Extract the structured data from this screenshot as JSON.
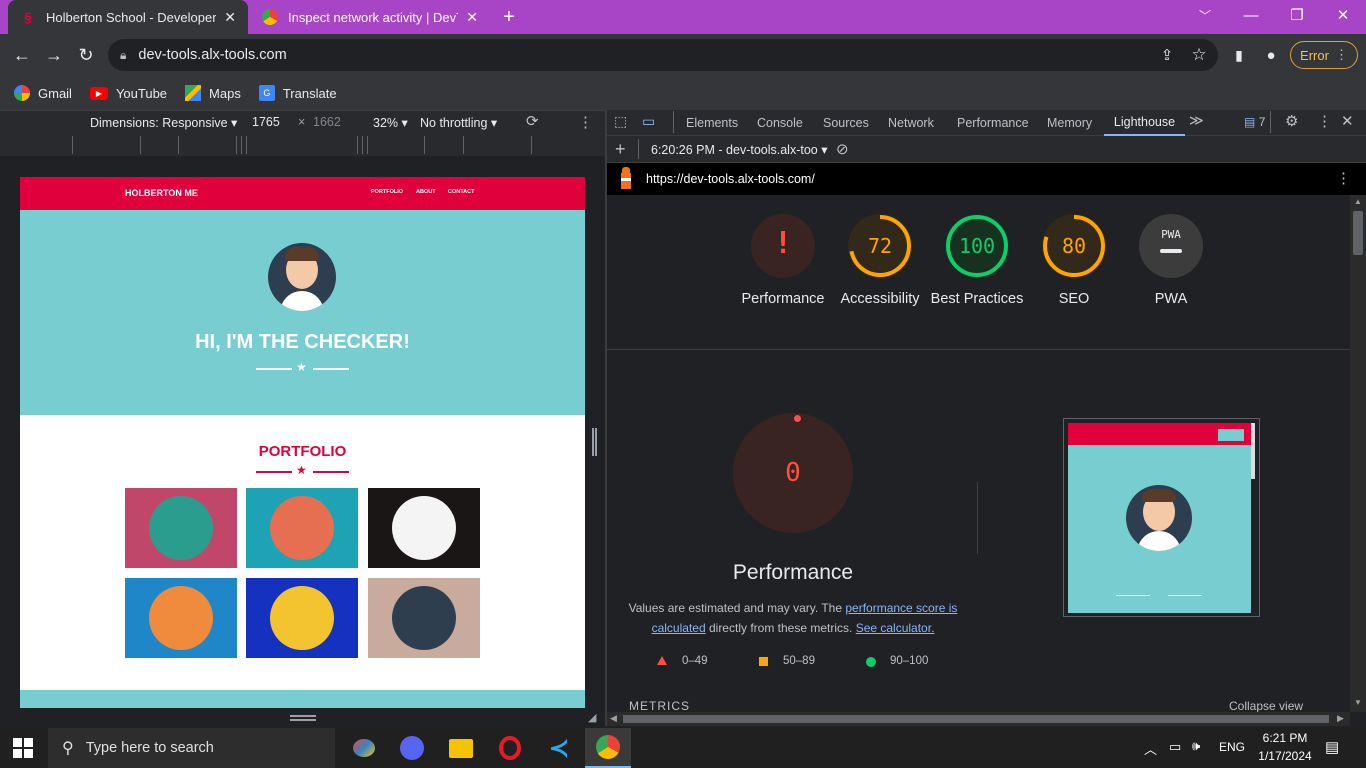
{
  "browser": {
    "tabs": [
      {
        "title": "Holberton School - Developer to",
        "active": true
      },
      {
        "title": "Inspect network activity | DevTo",
        "active": false
      }
    ],
    "new_tab": "+",
    "url": "dev-tools.alx-tools.com",
    "error_label": "Error",
    "bookmarks": [
      "Gmail",
      "YouTube",
      "Maps",
      "Translate"
    ]
  },
  "device_toolbar": {
    "dimensions": "Dimensions: Responsive",
    "width": "1765",
    "times": "×",
    "height": "1662",
    "zoom": "32%",
    "throttling": "No throttling"
  },
  "webpage": {
    "brand": "HOLBERTON ME",
    "nav": [
      "PORTFOLIO",
      "ABOUT",
      "CONTACT"
    ],
    "hero_title": "HI, I'M THE CHECKER!",
    "section_title": "PORTFOLIO",
    "tile_colors": [
      "#c1476a",
      "#1ea3b5",
      "#1a1616",
      "#1f86c8",
      "#1431c0",
      "#c9ab9e"
    ]
  },
  "devtools": {
    "tabs": [
      "Elements",
      "Console",
      "Sources",
      "Network",
      "Performance",
      "Memory",
      "Lighthouse"
    ],
    "active_tab": "Lighthouse",
    "issues_count": "7",
    "report_time": "6:20:26 PM - dev-tools.alx-too",
    "report_url": "https://dev-tools.alx-tools.com/",
    "scores": [
      {
        "label": "Performance",
        "value": "!",
        "color": "#ff4e42",
        "fraction": 0
      },
      {
        "label": "Accessibility",
        "value": "72",
        "color": "#ffa400",
        "fraction": 0.72
      },
      {
        "label": "Best Practices",
        "value": "100",
        "color": "#0cce6b",
        "fraction": 1.0
      },
      {
        "label": "SEO",
        "value": "80",
        "color": "#ffa400",
        "fraction": 0.8
      },
      {
        "label": "PWA",
        "value": "PWA",
        "color": "#9aa0a6",
        "fraction": 0
      }
    ],
    "perf": {
      "score": "0",
      "title": "Performance",
      "desc_1": "Values are estimated and may vary. The ",
      "link_1": "performance score is calculated",
      "desc_2": " directly from these metrics. ",
      "link_2": "See calculator.",
      "legend": [
        "0–49",
        "50–89",
        "90–100"
      ]
    },
    "metrics_label": "METRICS",
    "collapse_label": "Collapse view"
  },
  "taskbar": {
    "search_placeholder": "Type here to search",
    "lang": "ENG",
    "time": "6:21 PM",
    "date": "1/17/2024"
  }
}
